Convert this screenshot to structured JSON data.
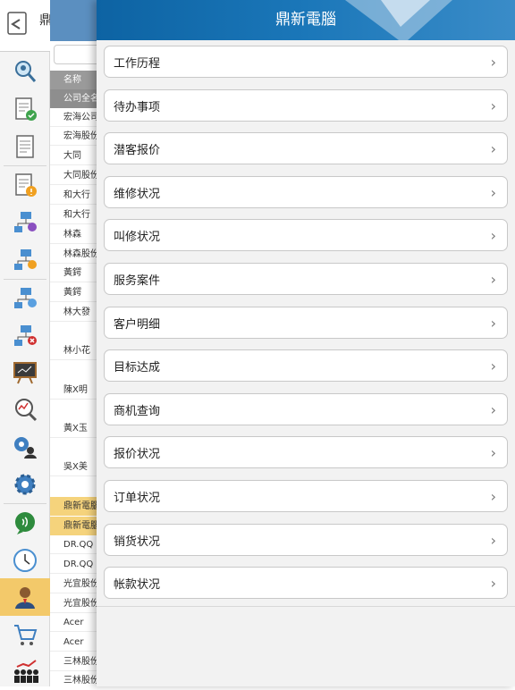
{
  "header": {
    "title": "鼎新電腦"
  },
  "rail": {
    "top_partial_text": "鼎",
    "icons": [
      "search-person-icon",
      "document-check-icon",
      "document-icon",
      "document-warning-icon",
      "network-settings-icon",
      "network-warning-icon",
      "network-user-icon",
      "network-error-icon",
      "presentation-board-icon",
      "chart-search-icon",
      "user-gear-icon",
      "gear-icon",
      "speech-bubble-icon",
      "clock-icon",
      "user-avatar-icon",
      "shopping-cart-icon",
      "team-chart-icon"
    ]
  },
  "list": {
    "header": "名称",
    "subheader": "公司全名",
    "rows": [
      "宏海公司",
      "宏海股份",
      "大同",
      "大同股份",
      "和大行",
      "和大行",
      "林森",
      "林森股份",
      "黃鍔",
      "黃鍔",
      "林大發",
      "林小花",
      "陳X明",
      "黃X玉",
      "吳X美",
      "鼎新電腦",
      "鼎新電腦",
      "DR.QQ",
      "DR.QQ",
      "光宜股份",
      "光宜股份",
      "Acer",
      "Acer",
      "三林股份",
      "三林股份"
    ]
  },
  "menu": {
    "items": [
      {
        "label": "工作历程"
      },
      {
        "label": "待办事项"
      },
      {
        "label": "潜客报价"
      },
      {
        "label": "维修状况"
      },
      {
        "label": "叫修状况"
      },
      {
        "label": "服务案件"
      },
      {
        "label": "客户明细"
      },
      {
        "label": "目标达成"
      },
      {
        "label": "商机查询"
      },
      {
        "label": "报价状况"
      },
      {
        "label": "订单状况"
      },
      {
        "label": "销货状况"
      },
      {
        "label": "帐款状况"
      }
    ],
    "chevron": "›"
  }
}
